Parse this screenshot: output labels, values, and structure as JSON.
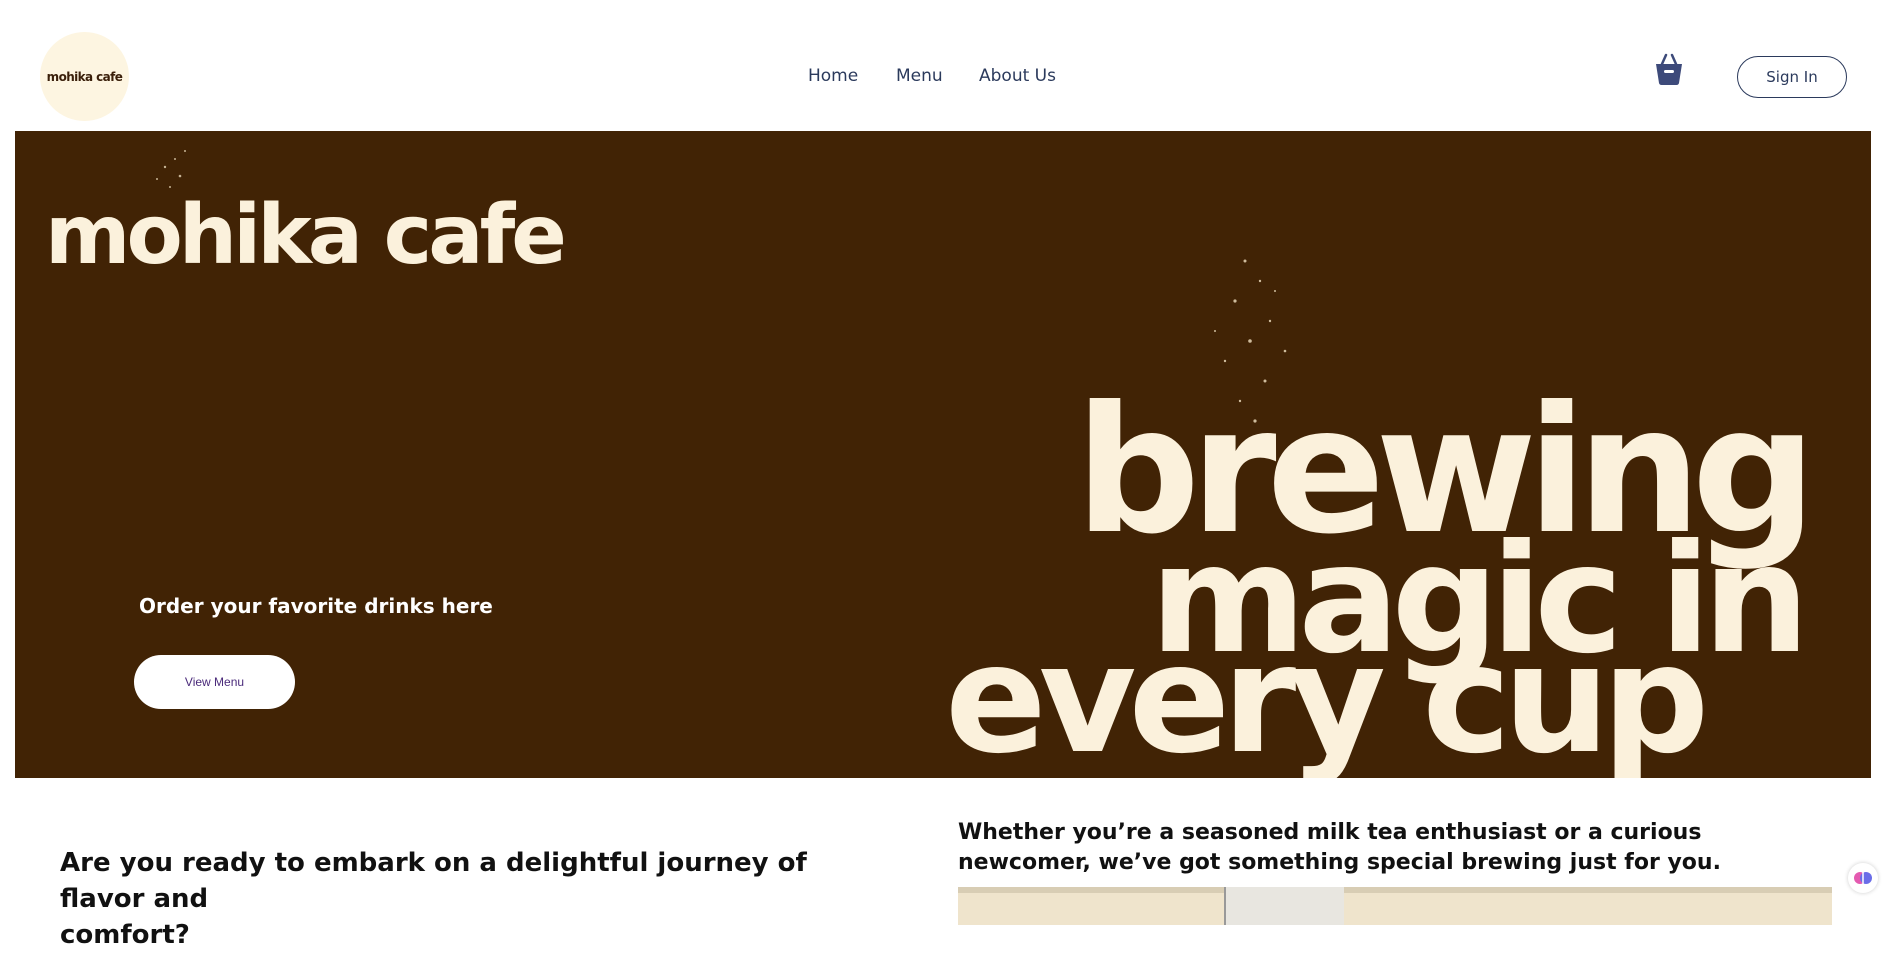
{
  "header": {
    "logo_text": "mohika cafe",
    "nav": [
      {
        "label": "Home"
      },
      {
        "label": "Menu"
      },
      {
        "label": "About Us"
      }
    ],
    "cart_icon": "basket-icon",
    "signin_label": "Sign In"
  },
  "hero": {
    "brand_text": "mohika cafe",
    "tagline": "Order your favorite drinks here",
    "cta_label": "View Menu",
    "slogan_lines": [
      "brewing",
      "magic in",
      "every cup"
    ],
    "colors": {
      "background": "#412305",
      "cream": "#fbf1dc"
    }
  },
  "intro": {
    "left_line1": "Are you ready to embark on a delightful journey of flavor and",
    "left_line2": "comfort?",
    "right_text": "Whether you’re a seasoned milk tea enthusiast or a curious newcomer, we’ve got something special brewing just for you."
  },
  "floater_icon": "brain-icon"
}
